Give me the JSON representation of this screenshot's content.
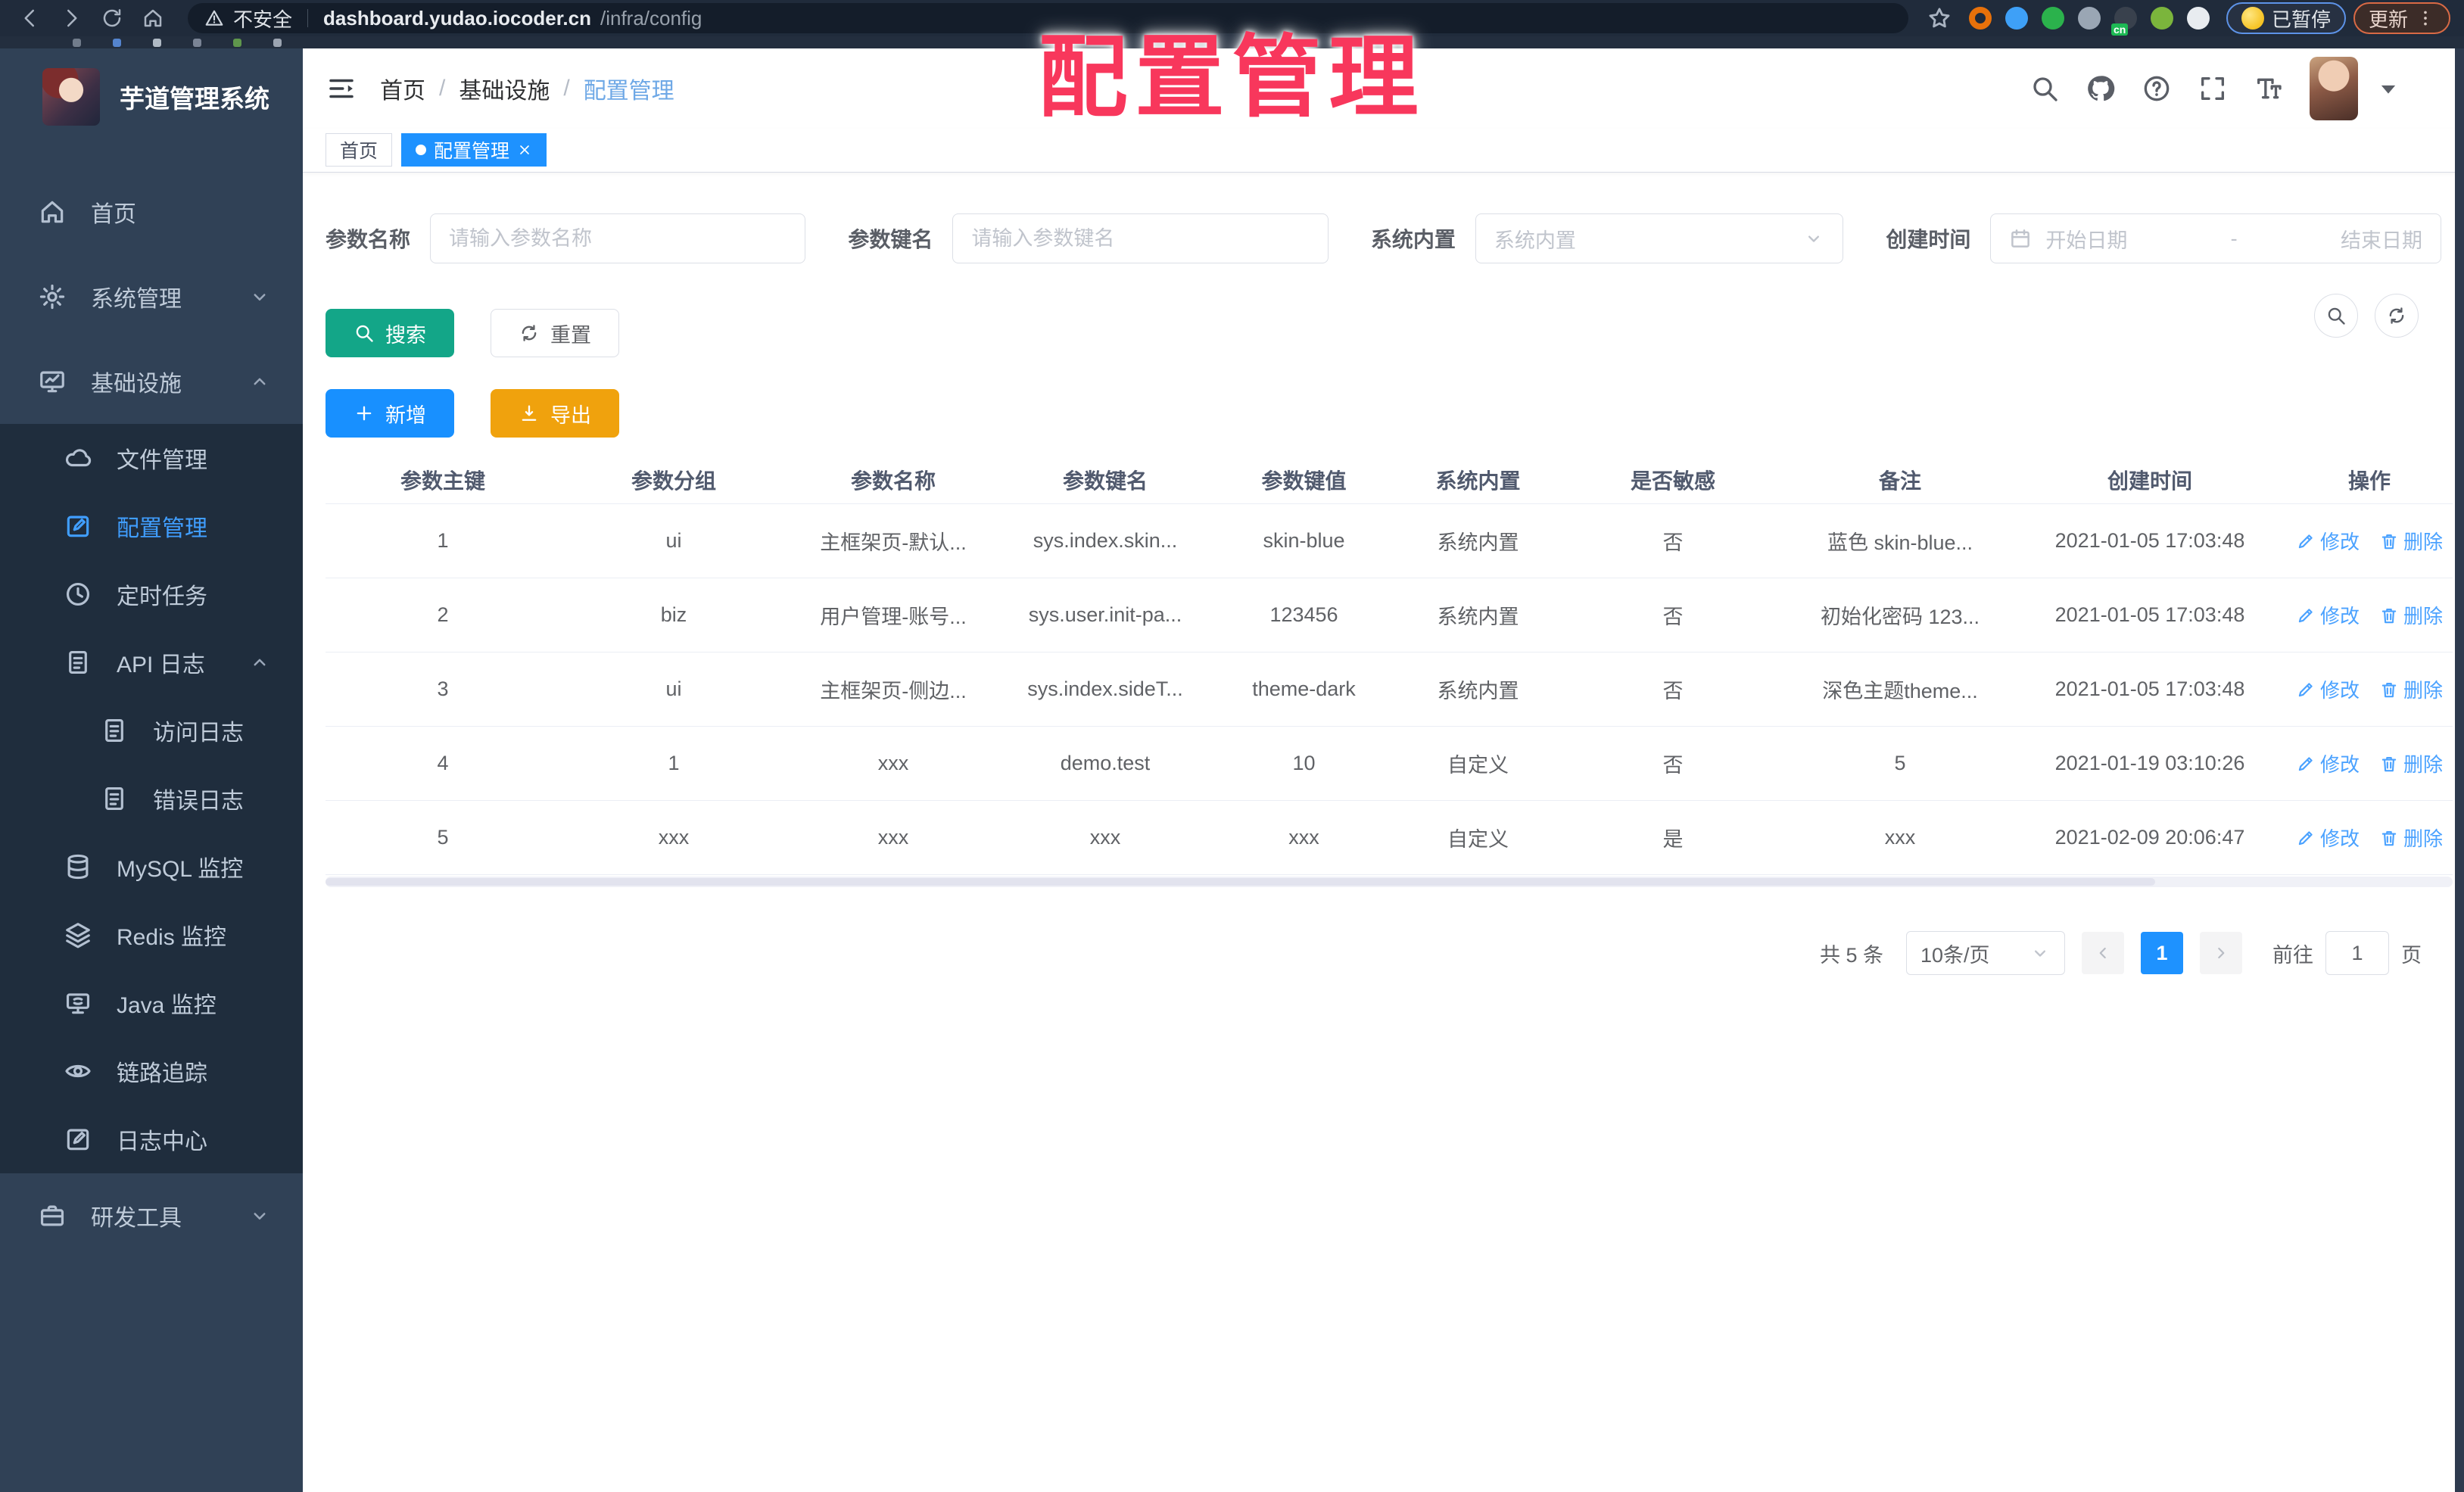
{
  "overlay": {
    "title": "配置管理"
  },
  "browser": {
    "security_label": "不安全",
    "url_host": "dashboard.yudao.iocoder.cn",
    "url_path": "/infra/config",
    "paused_badge": "已暂停",
    "update_label": "更新",
    "extensions": [
      {
        "name": "extension-orange-ring",
        "color": "#e8710a",
        "shape": "ring"
      },
      {
        "name": "extension-blue-pin",
        "color": "#3ea0f7",
        "shape": "dot"
      },
      {
        "name": "extension-green-check",
        "color": "#2bb24c",
        "shape": "dot"
      },
      {
        "name": "extension-grey-blue",
        "color": "#9aa6b4",
        "shape": "dot"
      },
      {
        "name": "extension-cn-translate",
        "color": "#39414d",
        "shape": "dot",
        "badge": "cn"
      },
      {
        "name": "extension-green-leaf",
        "color": "#7bb53c",
        "shape": "dot"
      },
      {
        "name": "extension-white-puzzle",
        "color": "#e8ecf0",
        "shape": "dot"
      }
    ],
    "bookmark_favicons": [
      "#7f8a99",
      "#5d93e8",
      "#c9d2dd",
      "#8a93a5",
      "#6aa84f",
      "#b0b9c6"
    ]
  },
  "sidebar": {
    "app_title": "芋道管理系统",
    "items": [
      {
        "label": "首页",
        "icon": "home",
        "level": 1,
        "active": false,
        "chevron": "",
        "group": false
      },
      {
        "label": "系统管理",
        "icon": "gear",
        "level": 1,
        "active": false,
        "chevron": "down",
        "group": false
      },
      {
        "label": "基础设施",
        "icon": "monitor",
        "level": 1,
        "active": false,
        "chevron": "up",
        "group": false
      },
      {
        "label": "文件管理",
        "icon": "cloud",
        "level": 2,
        "active": false,
        "chevron": "",
        "group": true
      },
      {
        "label": "配置管理",
        "icon": "edit",
        "level": 2,
        "active": true,
        "chevron": "",
        "group": true
      },
      {
        "label": "定时任务",
        "icon": "clock",
        "level": 2,
        "active": false,
        "chevron": "",
        "group": true
      },
      {
        "label": "API 日志",
        "icon": "log",
        "level": 2,
        "active": false,
        "chevron": "up",
        "group": true
      },
      {
        "label": "访问日志",
        "icon": "log",
        "level": 3,
        "active": false,
        "chevron": "",
        "group": true
      },
      {
        "label": "错误日志",
        "icon": "log",
        "level": 3,
        "active": false,
        "chevron": "",
        "group": true
      },
      {
        "label": "MySQL 监控",
        "icon": "db",
        "level": 2,
        "active": false,
        "chevron": "",
        "group": true
      },
      {
        "label": "Redis 监控",
        "icon": "layers",
        "level": 2,
        "active": false,
        "chevron": "",
        "group": true
      },
      {
        "label": "Java 监控",
        "icon": "java",
        "level": 2,
        "active": false,
        "chevron": "",
        "group": true
      },
      {
        "label": "链路追踪",
        "icon": "eye",
        "level": 2,
        "active": false,
        "chevron": "",
        "group": true
      },
      {
        "label": "日志中心",
        "icon": "edit",
        "level": 2,
        "active": false,
        "chevron": "",
        "group": true
      },
      {
        "label": "研发工具",
        "icon": "case",
        "level": 1,
        "active": false,
        "chevron": "down",
        "group": false
      }
    ]
  },
  "header": {
    "breadcrumb": [
      "首页",
      "基础设施",
      "配置管理"
    ],
    "separator": "/"
  },
  "tabs": [
    {
      "label": "首页",
      "active": false,
      "closable": false
    },
    {
      "label": "配置管理",
      "active": true,
      "closable": true
    }
  ],
  "filters": {
    "name": {
      "label": "参数名称",
      "placeholder": "请输入参数名称"
    },
    "key": {
      "label": "参数键名",
      "placeholder": "请输入参数键名"
    },
    "type": {
      "label": "系统内置",
      "placeholder": "系统内置"
    },
    "create_time": {
      "label": "创建时间",
      "start_placeholder": "开始日期",
      "separator": "-",
      "end_placeholder": "结束日期"
    }
  },
  "actions": {
    "search": "搜索",
    "reset": "重置",
    "add": "新增",
    "export": "导出"
  },
  "table": {
    "columns": [
      "参数主键",
      "参数分组",
      "参数名称",
      "参数键名",
      "参数键值",
      "系统内置",
      "是否敏感",
      "备注",
      "创建时间",
      "操作"
    ],
    "rows": [
      {
        "cells": [
          "1",
          "ui",
          "主框架页-默认...",
          "sys.index.skin...",
          "skin-blue",
          "系统内置",
          "否",
          "蓝色 skin-blue...",
          "2021-01-05 17:03:48"
        ]
      },
      {
        "cells": [
          "2",
          "biz",
          "用户管理-账号...",
          "sys.user.init-pa...",
          "123456",
          "系统内置",
          "否",
          "初始化密码 123...",
          "2021-01-05 17:03:48"
        ]
      },
      {
        "cells": [
          "3",
          "ui",
          "主框架页-侧边...",
          "sys.index.sideT...",
          "theme-dark",
          "系统内置",
          "否",
          "深色主题theme...",
          "2021-01-05 17:03:48"
        ]
      },
      {
        "cells": [
          "4",
          "1",
          "xxx",
          "demo.test",
          "10",
          "自定义",
          "否",
          "5",
          "2021-01-19 03:10:26"
        ]
      },
      {
        "cells": [
          "5",
          "xxx",
          "xxx",
          "xxx",
          "xxx",
          "自定义",
          "是",
          "xxx",
          "2021-02-09 20:06:47"
        ]
      }
    ],
    "row_actions": {
      "edit": "修改",
      "delete": "删除"
    }
  },
  "pagination": {
    "total": "共 5 条",
    "page_size": "10条/页",
    "current": "1",
    "goto_label": "前往",
    "goto_value": "1",
    "page_unit": "页"
  },
  "colors": {
    "accent": "#409eff",
    "sidebar_bg": "#304156",
    "submenu_bg": "#1f2d3d",
    "search_btn": "#13a688",
    "add_btn": "#1890ff",
    "export_btn": "#f0a20d",
    "tag_active": "#1e92ff",
    "annotation_red": "#f8375c"
  }
}
